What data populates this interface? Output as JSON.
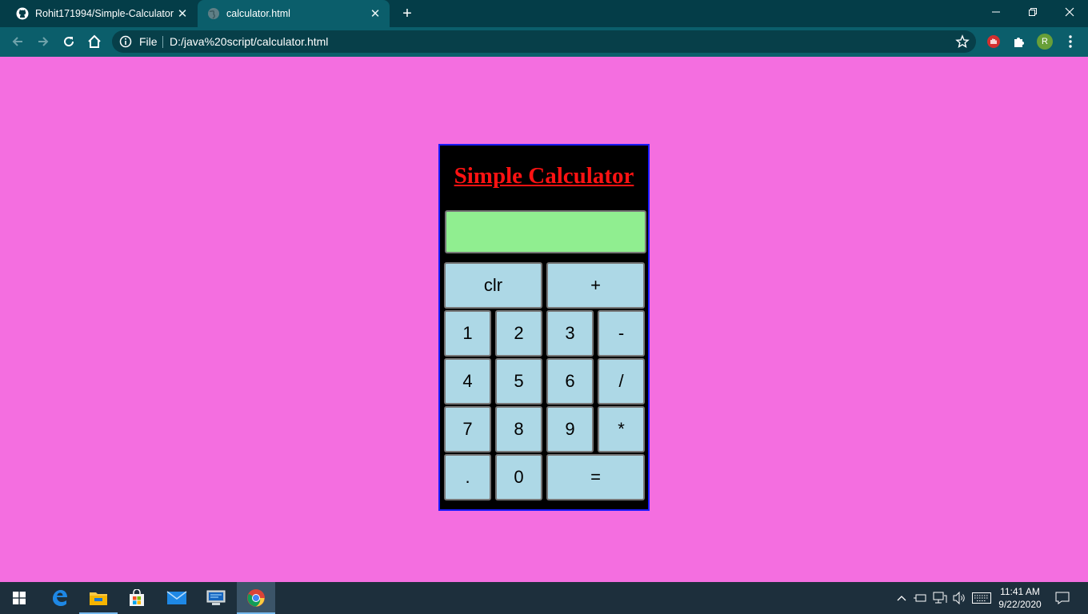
{
  "browser": {
    "tabs": [
      {
        "title": "Rohit171994/Simple-Calculator",
        "favicon": "github-icon",
        "active": false
      },
      {
        "title": "calculator.html",
        "favicon": "globe-icon",
        "active": true
      }
    ],
    "address": {
      "scheme_label": "File",
      "url": "D:/java%20script/calculator.html"
    },
    "profile_initial": "R"
  },
  "calculator": {
    "title": "Simple Calculator",
    "display_value": "",
    "keys": {
      "clr": "clr",
      "plus": "+",
      "k1": "1",
      "k2": "2",
      "k3": "3",
      "minus": "-",
      "k4": "4",
      "k5": "5",
      "k6": "6",
      "divide": "/",
      "k7": "7",
      "k8": "8",
      "k9": "9",
      "multiply": "*",
      "dot": ".",
      "k0": "0",
      "equals": "="
    },
    "colors": {
      "page_background": "#f46ee0",
      "panel_background": "#000000",
      "panel_border": "#1b1bff",
      "title": "#ff1212",
      "display": "#90ee90",
      "key": "#add8e6"
    }
  },
  "taskbar": {
    "apps": [
      "edge-icon",
      "file-explorer-icon",
      "store-icon",
      "mail-icon",
      "remote-desktop-icon",
      "chrome-icon"
    ],
    "time": "11:41 AM",
    "date": "9/22/2020"
  }
}
